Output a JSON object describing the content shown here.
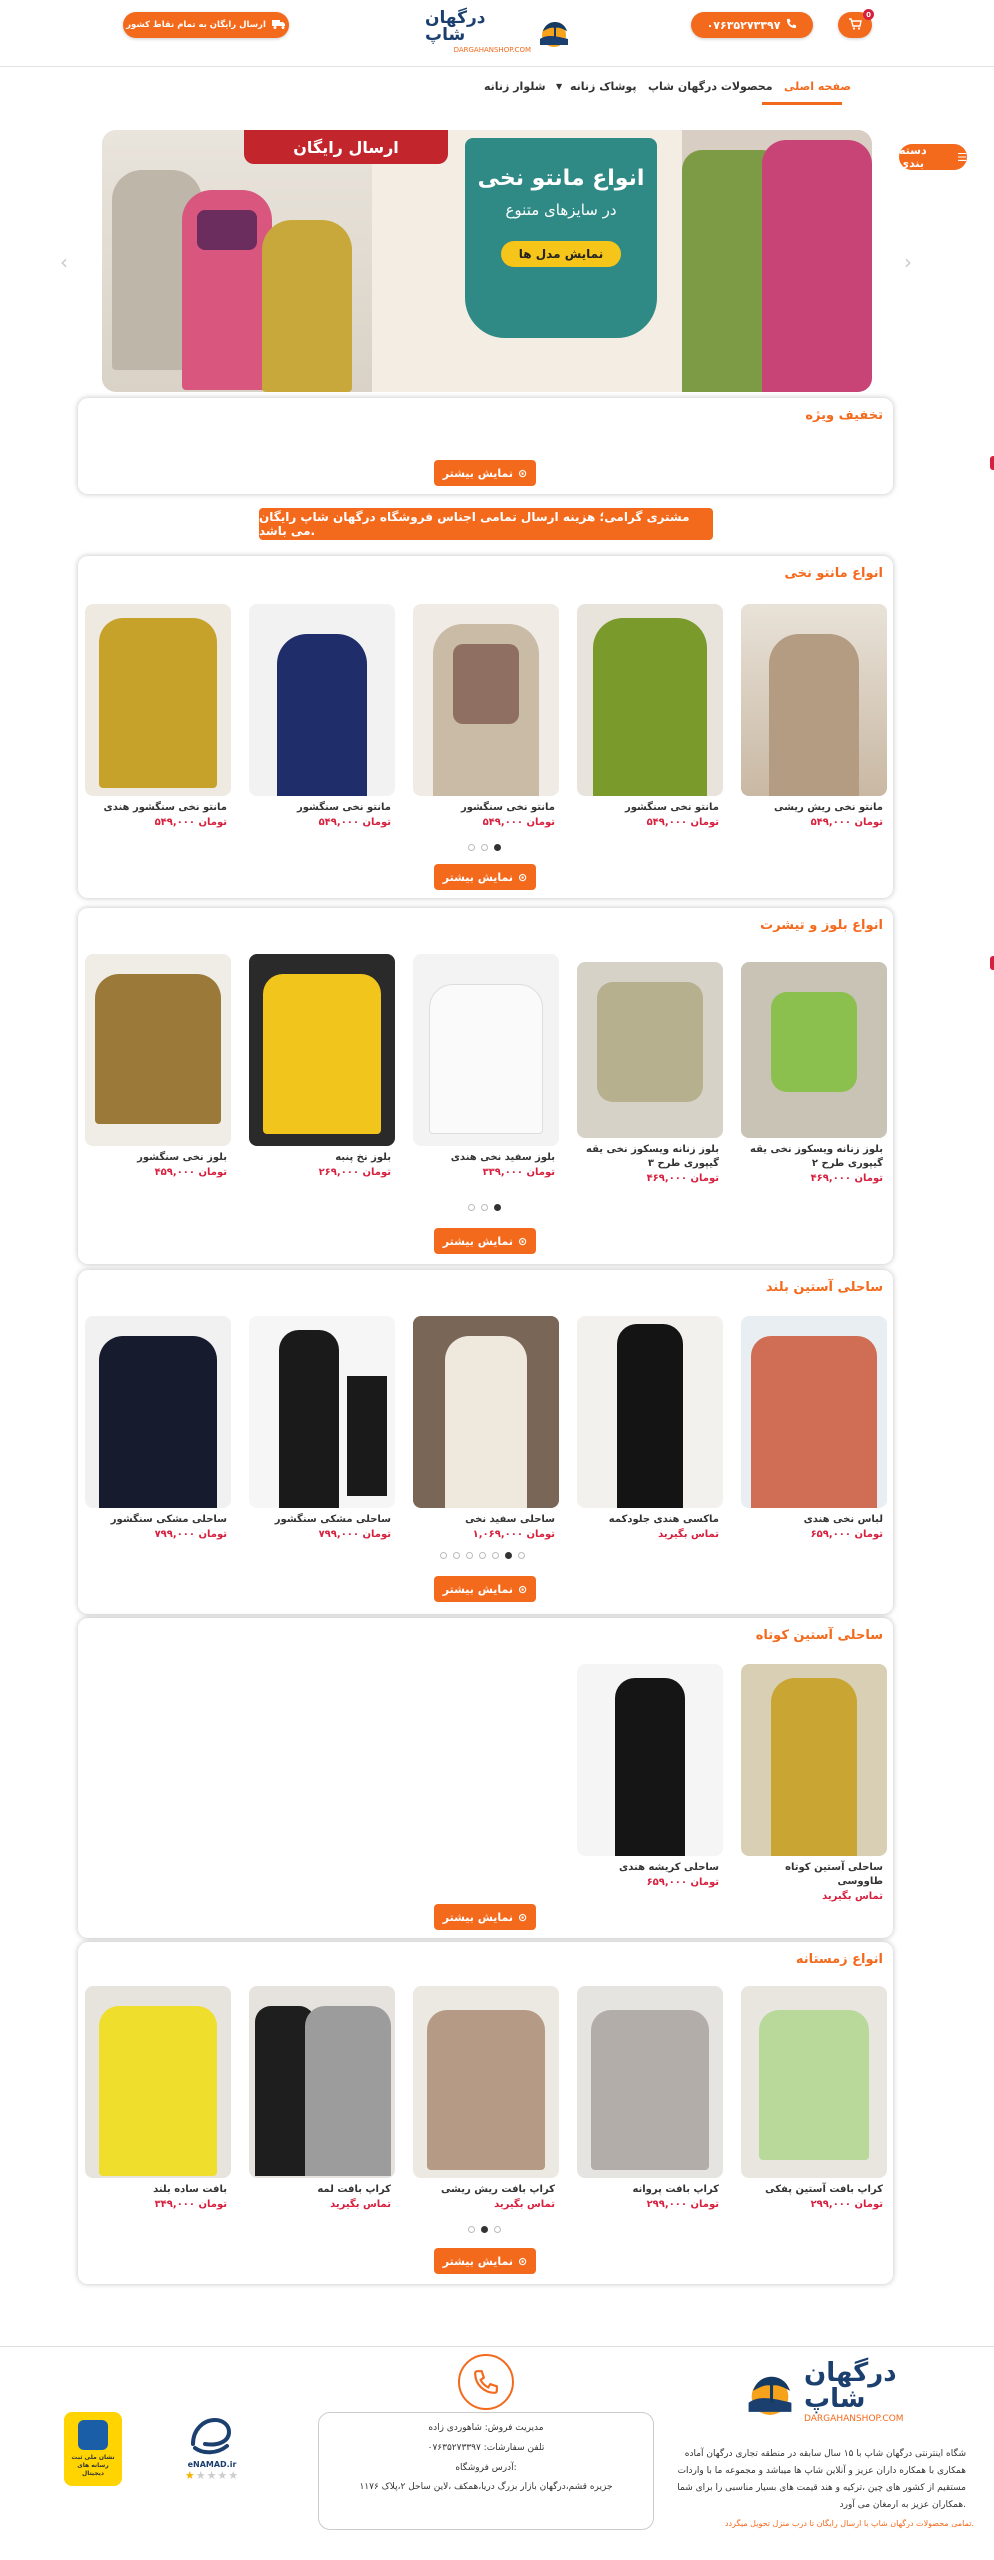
{
  "header": {
    "free_shipping": "ارسال رایگان به تمام نقاط کشور",
    "brand": "درگهان شاپ",
    "brand_domain": "DARGAHANSHOP.COM",
    "phone": "۰۷۶۳۵۲۷۳۳۹۷",
    "cart_count": "0"
  },
  "nav": {
    "categories": "دسته بندی",
    "home": "صفحه اصلی",
    "products": "محصولات درگهان شاپ",
    "women_clothing": "پوشاک زنانه",
    "women_pants": "شلوار زنانه"
  },
  "slider": {
    "free_shipping": "ارسال رایگان",
    "title_line1": "انواع مانتو نخی",
    "title_line2": "در سایزهای متنوع",
    "button": "نمایش مدل ها"
  },
  "special": {
    "title": "تخفیف ویژه",
    "more": "نمایش بیشتر"
  },
  "notice": "مشتری گرامی؛ هزینه ارسال تمامی اجناس فروشگاه درگهان شاپ رایگان می باشد.",
  "sections": [
    {
      "title": "انواع مانتو نخی",
      "more": "نمایش بیشتر",
      "products": [
        {
          "name": "مانتو نخی ریش ریشی",
          "price": "۵۴۹,۰۰۰ تومان"
        },
        {
          "name": "مانتو نخی سنگشور",
          "price": "۵۴۹,۰۰۰ تومان"
        },
        {
          "name": "مانتو نخی سنگشور",
          "price": "۵۴۹,۰۰۰ تومان"
        },
        {
          "name": "مانتو نخی سنگشور",
          "price": "۵۴۹,۰۰۰ تومان"
        },
        {
          "name": "مانتو نخی سنگشور هندی",
          "price": "۵۴۹,۰۰۰ تومان"
        }
      ]
    },
    {
      "title": "انواع بلوز و تیشرت",
      "more": "نمایش بیشتر",
      "products": [
        {
          "name": "بلوز زنانه ویسکوز نخی یقه گیپوری طرح ۲",
          "price": "۴۶۹,۰۰۰ تومان"
        },
        {
          "name": "بلوز زنانه ویسکوز نخی یقه گیپوری طرح ۳",
          "price": "۴۶۹,۰۰۰ تومان"
        },
        {
          "name": "بلوز سفید نخی هندی",
          "price": "۳۳۹,۰۰۰ تومان"
        },
        {
          "name": "بلوز نخ پنبه",
          "price": "۲۶۹,۰۰۰ تومان"
        },
        {
          "name": "بلوز نخی سنگشور",
          "price": "۴۵۹,۰۰۰ تومان"
        }
      ]
    },
    {
      "title": "ساحلی آستین بلند",
      "more": "نمایش بیشتر",
      "products": [
        {
          "name": "لباس نخی هندی",
          "price": "۶۵۹,۰۰۰ تومان"
        },
        {
          "name": "ماکسی هندی جلودکمه",
          "price": "تماس بگیرید"
        },
        {
          "name": "ساحلی سفید نخی",
          "price": "۱,۰۶۹,۰۰۰ تومان"
        },
        {
          "name": "ساحلی مشکی سنگشور",
          "price": "۷۹۹,۰۰۰ تومان"
        },
        {
          "name": "ساحلی مشکی سنگشور",
          "price": "۷۹۹,۰۰۰ تومان"
        }
      ]
    },
    {
      "title": "ساحلی آستین کوتاه",
      "more": "نمایش بیشتر",
      "products": [
        {
          "name": "ساحلی آستین کوتاه طاووسی",
          "price": "تماس بگیرید"
        },
        {
          "name": "ساحلی کریشه هندی",
          "price": "۶۵۹,۰۰۰ تومان"
        }
      ]
    },
    {
      "title": "انواع زمستانه",
      "more": "نمایش بیشتر",
      "products": [
        {
          "name": "کراپ بافت آستین پفکی",
          "price": "۲۹۹,۰۰۰ تومان"
        },
        {
          "name": "کراپ بافت پروانه",
          "price": "۲۹۹,۰۰۰ تومان"
        },
        {
          "name": "کراپ بافت ریش ریشی",
          "price": "تماس بگیرید"
        },
        {
          "name": "کراپ بافت لمه",
          "price": "تماس بگیرید"
        },
        {
          "name": "بافت ساده بلند",
          "price": "۳۴۹,۰۰۰ تومان"
        }
      ]
    }
  ],
  "footer": {
    "brand": "درگهان شاپ",
    "brand_domain": "DARGAHANSHOP.COM",
    "about": "شگاه اینترنتی درگهان شاپ با ۱۵ سال سابقه در منطقه تجاری درگهان آماده همکاری با همکاره داران عزیز و آنلاین شاپ ها میباشد و مجموعه ما با واردات مستقیم از کشور های چین ،ترکیه و هند قیمت های بسیار مناسبی را برای شما همکاران عزیز به ارمغان می آورد.",
    "bottom_text": "تمامی محصولات درگهان شاپ با ارسال رایگان تا درب منزل تحویل میگردد.",
    "manager": "مدیریت فروش: شاهوردی زاده",
    "order_phone": "تلفن سفارشات: ۰۷۶۳۵۲۷۳۳۹۷",
    "address_label": "آدرس فروشگاه:",
    "address": "جزیره قشم،درگهان بازار بزرگ دریا،همکف ،لاین ساحل ۲،پلاک ۱۱۷۶",
    "enamad": "eNAMAD.ir",
    "badge_text": "نشان ملی ثبت رسانه های دیجیتال"
  },
  "colors": {
    "accent": "#f36a1d",
    "price": "#d6203e",
    "navy": "#1b3f6e"
  }
}
